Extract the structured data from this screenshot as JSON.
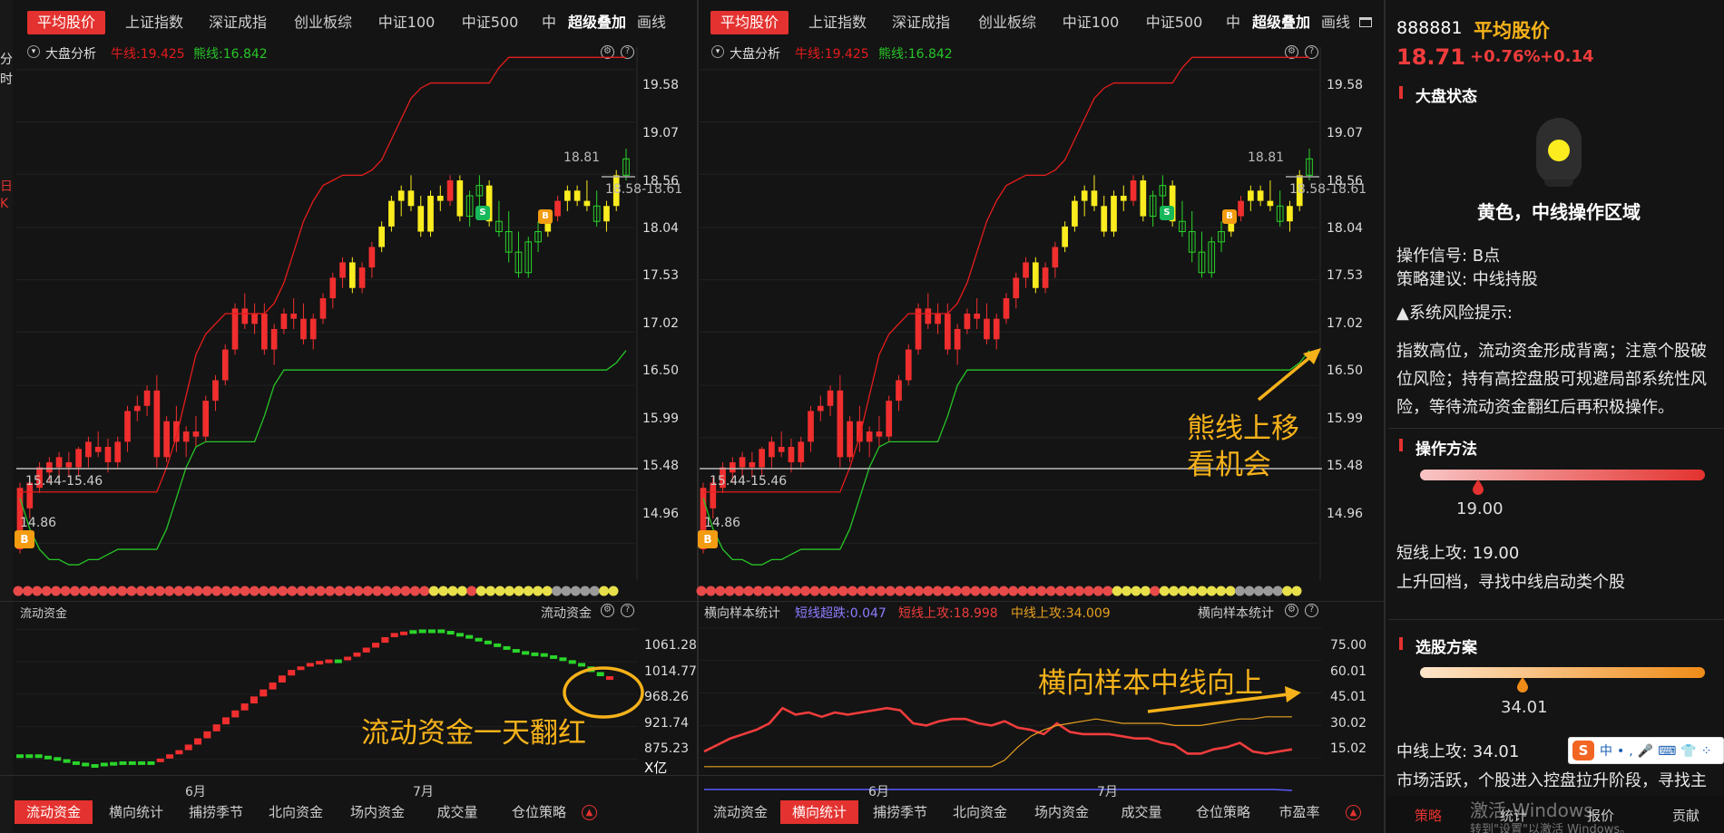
{
  "colors": {
    "up": "#f02e2e",
    "down": "#2ad42a",
    "yellow": "#fbec1f",
    "accent": "#e3322f",
    "annotation": "#f6b21a",
    "bear": "#27c427",
    "bull": "#e51c1c"
  },
  "left_panel": {
    "tabs": [
      "平均股价",
      "上证指数",
      "深证成指",
      "创业板综",
      "中证100",
      "中证500",
      "中",
      "超级叠加",
      "画线"
    ],
    "legend": {
      "name": "大盘分析",
      "bull": "牛线:19.425",
      "bear": "熊线:16.842"
    },
    "price_axis": [
      "19.58",
      "19.07",
      "18.56",
      "18.04",
      "17.53",
      "17.02",
      "16.50",
      "15.99",
      "15.48",
      "14.96"
    ],
    "price_labels": {
      "high": "18.81",
      "current": "18.58-18.61",
      "support": "15.44-15.46",
      "low": "14.86"
    },
    "sub_title": "流动资金",
    "sub_title_right": "流动资金",
    "sub_axis": [
      "1061.28",
      "1014.77",
      "968.26",
      "921.74",
      "875.23"
    ],
    "sub_unit": "X亿",
    "months": [
      "6月",
      "7月"
    ],
    "annotation": "流动资金一天翻红",
    "bottom_tabs": [
      "流动资金",
      "横向统计",
      "捕捞季节",
      "北向资金",
      "场内资金",
      "成交量",
      "仓位策略"
    ]
  },
  "right_chart": {
    "tabs": [
      "平均股价",
      "上证指数",
      "深证成指",
      "创业板综",
      "中证100",
      "中证500",
      "中",
      "超级叠加",
      "画线"
    ],
    "legend": {
      "name": "大盘分析",
      "bull": "牛线:19.425",
      "bear": "熊线:16.842"
    },
    "price_axis": [
      "19.58",
      "19.07",
      "18.56",
      "18.04",
      "17.53",
      "17.02",
      "16.50",
      "15.99",
      "15.48",
      "14.96"
    ],
    "price_labels": {
      "high": "18.81",
      "current": "18.58-18.61",
      "support": "15.44-15.46",
      "low": "14.86"
    },
    "sub_title": "横向样本统计",
    "sub_title_right": "横向样本统计",
    "sub_stats": {
      "short_break": "短线超跌:0.047",
      "short_attack": "短线上攻:18.998",
      "mid_attack": "中线上攻:34.009"
    },
    "sub_axis": [
      "75.00",
      "60.01",
      "45.01",
      "30.02",
      "15.02"
    ],
    "months": [
      "6月",
      "7月"
    ],
    "annotation_1": "熊线上移",
    "annotation_2": "看机会",
    "annotation_sub": "横向样本中线向上",
    "bottom_tabs": [
      "流动资金",
      "横向统计",
      "捕捞季节",
      "北向资金",
      "场内资金",
      "成交量",
      "仓位策略",
      "市盈率"
    ]
  },
  "stock_panel": {
    "code": "888881",
    "name": "平均股价",
    "price": "18.71",
    "change_pct": "+0.76%",
    "change": "+0.14",
    "market_state_title": "大盘状态",
    "market_state_text": "黄色，中线操作区域",
    "signal": "操作信号: B点",
    "advice": "策略建议: 中线持股",
    "risk_title": "▲系统风险提示:",
    "risk_lines": [
      "指数高位，流动资金形成背离；注意个股破",
      "位风险；持有高控盘股可规避局部系统性风",
      "险，等待流动资金翻红后再积极操作。"
    ],
    "op_title": "操作方法",
    "op_value": "19.00",
    "op_line1": "短线上攻:  19.00",
    "op_line2": "上升回档，寻找中线启动类个股",
    "select_title": "选股方案",
    "select_value": "34.01",
    "select_line1": "中线上攻:  34.01",
    "select_line2": "市场活跃，个股进入控盘拉升阶段，寻找主",
    "bottom_tabs": [
      "策略",
      "统计",
      "报价",
      "贡献"
    ]
  },
  "left_edge": {
    "chars": [
      "分",
      "时",
      "日",
      "K"
    ]
  },
  "watermark": {
    "line1": "激活 Windows",
    "line2": "转到\"设置\"以激活 Windows。"
  },
  "chart_data": [
    {
      "type": "candlestick",
      "title": "大盘分析",
      "ylim": [
        14.6,
        19.8
      ],
      "yticks": [
        19.58,
        19.07,
        18.56,
        18.04,
        17.53,
        17.02,
        16.5,
        15.99,
        15.48,
        14.96
      ],
      "candles": [
        [
          14.9,
          15.55,
          14.86,
          15.5
        ],
        [
          15.3,
          15.6,
          15.2,
          15.55
        ],
        [
          15.5,
          15.75,
          15.45,
          15.7
        ],
        [
          15.65,
          15.8,
          15.55,
          15.75
        ],
        [
          15.7,
          15.85,
          15.6,
          15.8
        ],
        [
          15.75,
          15.85,
          15.6,
          15.7
        ],
        [
          15.7,
          15.9,
          15.62,
          15.88
        ],
        [
          15.8,
          16.0,
          15.7,
          15.95
        ],
        [
          15.85,
          16.05,
          15.8,
          15.9
        ],
        [
          15.9,
          15.98,
          15.65,
          15.75
        ],
        [
          15.75,
          16.0,
          15.7,
          15.95
        ],
        [
          15.95,
          16.3,
          15.85,
          16.25
        ],
        [
          16.25,
          16.4,
          16.15,
          16.3
        ],
        [
          16.3,
          16.5,
          16.2,
          16.45
        ],
        [
          16.45,
          16.6,
          15.7,
          15.8
        ],
        [
          15.8,
          16.2,
          15.75,
          16.15
        ],
        [
          16.15,
          16.3,
          15.85,
          15.95
        ],
        [
          15.95,
          16.1,
          15.8,
          16.05
        ],
        [
          16.05,
          16.2,
          15.9,
          16.0
        ],
        [
          16.0,
          16.4,
          15.95,
          16.35
        ],
        [
          16.35,
          16.6,
          16.25,
          16.55
        ],
        [
          16.55,
          16.9,
          16.5,
          16.85
        ],
        [
          16.85,
          17.3,
          16.8,
          17.25
        ],
        [
          17.25,
          17.4,
          17.05,
          17.1
        ],
        [
          17.1,
          17.3,
          17.0,
          17.2
        ],
        [
          17.2,
          17.3,
          16.8,
          16.85
        ],
        [
          16.85,
          17.1,
          16.7,
          17.05
        ],
        [
          17.05,
          17.25,
          17.0,
          17.2
        ],
        [
          17.2,
          17.35,
          17.05,
          17.15
        ],
        [
          17.15,
          17.3,
          16.9,
          16.95
        ],
        [
          16.95,
          17.2,
          16.85,
          17.15
        ],
        [
          17.15,
          17.4,
          17.1,
          17.35
        ],
        [
          17.35,
          17.6,
          17.25,
          17.55
        ],
        [
          17.55,
          17.75,
          17.45,
          17.7
        ],
        [
          17.7,
          17.75,
          17.4,
          17.45
        ],
        [
          17.45,
          17.7,
          17.4,
          17.65
        ],
        [
          17.65,
          17.9,
          17.55,
          17.85
        ],
        [
          17.85,
          18.1,
          17.8,
          18.05
        ],
        [
          18.05,
          18.35,
          18.0,
          18.3
        ],
        [
          18.3,
          18.45,
          18.15,
          18.4
        ],
        [
          18.4,
          18.55,
          18.2,
          18.25
        ],
        [
          18.25,
          18.35,
          17.95,
          18.0
        ],
        [
          18.0,
          18.4,
          17.95,
          18.35
        ],
        [
          18.35,
          18.45,
          18.2,
          18.3
        ],
        [
          18.3,
          18.55,
          18.25,
          18.5
        ],
        [
          18.5,
          18.55,
          18.1,
          18.15
        ],
        [
          18.15,
          18.4,
          18.05,
          18.35
        ],
        [
          18.35,
          18.55,
          18.25,
          18.45
        ],
        [
          18.45,
          18.5,
          18.05,
          18.1
        ],
        [
          18.1,
          18.3,
          17.95,
          18.0
        ],
        [
          18.0,
          18.2,
          17.7,
          17.8
        ],
        [
          17.8,
          18.0,
          17.55,
          17.6
        ],
        [
          17.6,
          17.95,
          17.55,
          17.9
        ],
        [
          17.9,
          18.1,
          17.8,
          18.0
        ],
        [
          18.0,
          18.2,
          17.95,
          18.15
        ],
        [
          18.15,
          18.35,
          18.1,
          18.3
        ],
        [
          18.3,
          18.45,
          18.2,
          18.4
        ],
        [
          18.4,
          18.45,
          18.25,
          18.3
        ],
        [
          18.3,
          18.5,
          18.2,
          18.25
        ],
        [
          18.25,
          18.4,
          18.05,
          18.1
        ],
        [
          18.1,
          18.3,
          18.0,
          18.25
        ],
        [
          18.25,
          18.6,
          18.2,
          18.55
        ],
        [
          18.55,
          18.81,
          18.5,
          18.71
        ]
      ],
      "candle_colors": [
        "r",
        "r",
        "r",
        "r",
        "r",
        "r",
        "r",
        "r",
        "r",
        "r",
        "r",
        "r",
        "r",
        "r",
        "r",
        "r",
        "r",
        "r",
        "r",
        "r",
        "r",
        "r",
        "r",
        "r",
        "r",
        "r",
        "r",
        "r",
        "r",
        "r",
        "r",
        "r",
        "r",
        "r",
        "y",
        "r",
        "r",
        "y",
        "y",
        "y",
        "y",
        "y",
        "y",
        "y",
        "r",
        "y",
        "g",
        "g",
        "y",
        "g",
        "g",
        "g",
        "g",
        "g",
        "y",
        "r",
        "y",
        "y",
        "y",
        "g",
        "y",
        "y",
        "g"
      ],
      "bull_line": [
        15.46,
        15.46,
        15.46,
        15.46,
        15.46,
        15.46,
        15.46,
        15.46,
        15.46,
        15.46,
        15.46,
        15.46,
        15.46,
        15.46,
        15.46,
        15.7,
        16.0,
        16.4,
        16.8,
        17.0,
        17.1,
        17.2,
        17.2,
        17.2,
        17.2,
        17.2,
        17.3,
        17.5,
        17.8,
        18.1,
        18.3,
        18.45,
        18.5,
        18.55,
        18.55,
        18.55,
        18.6,
        18.7,
        18.9,
        19.1,
        19.3,
        19.4,
        19.45,
        19.45,
        19.45,
        19.45,
        19.45,
        19.45,
        19.45,
        19.6,
        19.7,
        19.7,
        19.7,
        19.7,
        19.7,
        19.7,
        19.7,
        19.7,
        19.7,
        19.7,
        19.7,
        19.7,
        19.7
      ],
      "bear_line": [
        15.4,
        15.1,
        14.9,
        14.8,
        14.8,
        14.75,
        14.75,
        14.8,
        14.8,
        14.85,
        14.9,
        14.9,
        14.9,
        14.9,
        14.9,
        15.1,
        15.4,
        15.7,
        15.9,
        15.95,
        15.95,
        15.95,
        15.95,
        15.95,
        15.95,
        16.2,
        16.5,
        16.65,
        16.65,
        16.65,
        16.65,
        16.65,
        16.65,
        16.65,
        16.65,
        16.65,
        16.65,
        16.65,
        16.65,
        16.65,
        16.65,
        16.65,
        16.65,
        16.65,
        16.65,
        16.65,
        16.65,
        16.65,
        16.65,
        16.65,
        16.65,
        16.65,
        16.65,
        16.65,
        16.65,
        16.65,
        16.65,
        16.65,
        16.65,
        16.65,
        16.65,
        16.72,
        16.84
      ]
    },
    {
      "type": "bar",
      "title": "流动资金",
      "ylim": [
        855,
        1085
      ],
      "yticks": [
        1061.28,
        1014.77,
        968.26,
        921.74,
        875.23
      ],
      "values": [
        882,
        882,
        880,
        878,
        875,
        872,
        870,
        868,
        868,
        870,
        871,
        872,
        872,
        871,
        872,
        876,
        882,
        888,
        896,
        905,
        915,
        925,
        935,
        945,
        955,
        965,
        975,
        985,
        995,
        1003,
        1008,
        1013,
        1016,
        1018,
        1018,
        1022,
        1028,
        1035,
        1042,
        1050,
        1056,
        1058,
        1060,
        1061,
        1061,
        1059,
        1056,
        1053,
        1049,
        1045,
        1041,
        1037,
        1033,
        1030,
        1028,
        1027,
        1024,
        1021,
        1017,
        1013,
        1008,
        1000,
        994,
        992
      ],
      "colors": [
        "g",
        "g",
        "g",
        "g",
        "g",
        "g",
        "g",
        "g",
        "g",
        "g",
        "g",
        "g",
        "g",
        "g",
        "g",
        "r",
        "r",
        "r",
        "r",
        "r",
        "r",
        "r",
        "r",
        "r",
        "r",
        "r",
        "r",
        "r",
        "r",
        "r",
        "r",
        "r",
        "r",
        "r",
        "g",
        "r",
        "r",
        "r",
        "r",
        "r",
        "r",
        "r",
        "g",
        "g",
        "g",
        "g",
        "g",
        "g",
        "g",
        "g",
        "g",
        "g",
        "g",
        "g",
        "g",
        "g",
        "g",
        "g",
        "g",
        "g",
        "g",
        "g",
        "g",
        "r"
      ]
    },
    {
      "type": "line",
      "title": "横向样本统计",
      "ylim": [
        8,
        82
      ],
      "yticks": [
        75.0,
        60.01,
        45.01,
        30.02,
        15.02
      ],
      "series": [
        {
          "name": "短线超跌",
          "values": [
            0.5,
            0.5,
            0.5,
            0.5,
            0.5,
            0.5,
            0.5,
            0.5,
            0.5,
            0.5,
            0.5,
            0.5,
            0.5,
            0.5,
            0.5,
            0.5,
            0.5,
            0.5,
            0.5,
            0.5,
            0.5,
            0.5,
            0.5,
            0.5,
            0.5,
            0.5,
            0.5,
            0.5,
            0.5,
            0.5,
            0.5,
            0.5,
            0.047
          ]
        },
        {
          "name": "短线上攻",
          "values": [
            18,
            21,
            24,
            26,
            28,
            31,
            38,
            35,
            36,
            34,
            36,
            35,
            36,
            37,
            38,
            37,
            31,
            30,
            32,
            33,
            33,
            31,
            30,
            32,
            29,
            28,
            26,
            31,
            27,
            26,
            26,
            26,
            25,
            24,
            24,
            22,
            21,
            17,
            17,
            19,
            20,
            22,
            18,
            17,
            18,
            19
          ]
        },
        {
          "name": "中线上攻",
          "values": [
            11,
            11,
            11,
            11,
            11,
            11,
            11,
            11,
            11,
            11,
            11,
            11,
            11,
            11,
            11,
            11,
            11,
            11,
            11,
            11,
            11,
            11,
            11,
            14,
            20,
            25,
            28,
            30,
            31,
            32,
            33,
            32,
            31,
            31,
            31,
            31,
            30,
            30,
            30,
            31,
            32,
            33,
            33,
            34,
            34,
            34
          ]
        }
      ]
    }
  ]
}
